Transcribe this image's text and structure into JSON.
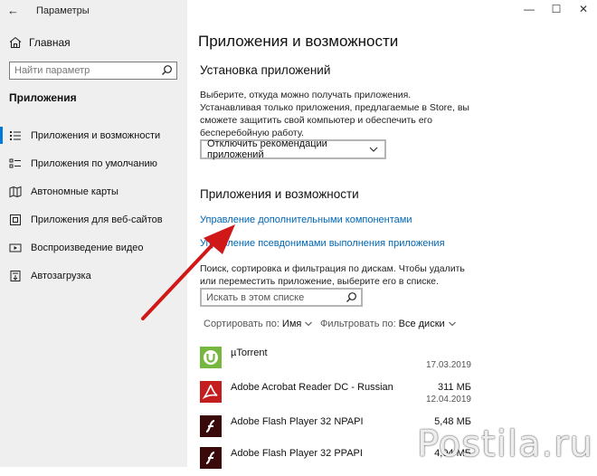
{
  "window": {
    "title": "Параметры",
    "controls": {
      "minimize": "—",
      "maximize": "☐",
      "close": "✕"
    }
  },
  "sidebar": {
    "back_icon": "←",
    "home_label": "Главная",
    "search_placeholder": "Найти параметр",
    "section_label": "Приложения",
    "items": [
      {
        "label": "Приложения и возможности",
        "icon": "apps-list-icon",
        "active": true
      },
      {
        "label": "Приложения по умолчанию",
        "icon": "default-apps-icon",
        "active": false
      },
      {
        "label": "Автономные карты",
        "icon": "offline-maps-icon",
        "active": false
      },
      {
        "label": "Приложения для веб-сайтов",
        "icon": "web-apps-icon",
        "active": false
      },
      {
        "label": "Воспроизведение видео",
        "icon": "video-playback-icon",
        "active": false
      },
      {
        "label": "Автозагрузка",
        "icon": "startup-icon",
        "active": false
      }
    ]
  },
  "main": {
    "page_title": "Приложения и возможности",
    "install_heading": "Установка приложений",
    "install_desc": "Выберите, откуда можно получать приложения. Устанавливая только приложения, предлагаемые в Store, вы сможете защитить свой компьютер и обеспечить его бесперебойную работу.",
    "install_dropdown": "Отключить рекомендации приложений",
    "apps_heading": "Приложения и возможности",
    "link_optional": "Управление дополнительными компонентами",
    "link_aliases": "Управление псевдонимами выполнения приложения",
    "filter_desc": "Поиск, сортировка и фильтрация по дискам. Чтобы удалить или переместить приложение, выберите его в списке.",
    "list_search_placeholder": "Искать в этом списке",
    "sort_label": "Сортировать по:",
    "sort_value": "Имя",
    "filter_label": "Фильтровать по:",
    "filter_value": "Все диски",
    "apps": [
      {
        "name": "µTorrent",
        "size": "",
        "date": "17.03.2019",
        "icon": "utorrent-icon"
      },
      {
        "name": "Adobe Acrobat Reader DC - Russian",
        "size": "311 МБ",
        "date": "12.04.2019",
        "icon": "acrobat-icon"
      },
      {
        "name": "Adobe Flash Player 32 NPAPI",
        "size": "5,48 МБ",
        "date": "",
        "icon": "flash-icon"
      },
      {
        "name": "Adobe Flash Player 32 PPAPI",
        "size": "4,04 МБ",
        "date": "",
        "icon": "flash-icon"
      }
    ]
  },
  "watermark": "Postila.ru",
  "colors": {
    "accent": "#0078d7",
    "link": "#0066b4",
    "arrow": "#d01818",
    "sidebar_bg": "#efefef"
  }
}
